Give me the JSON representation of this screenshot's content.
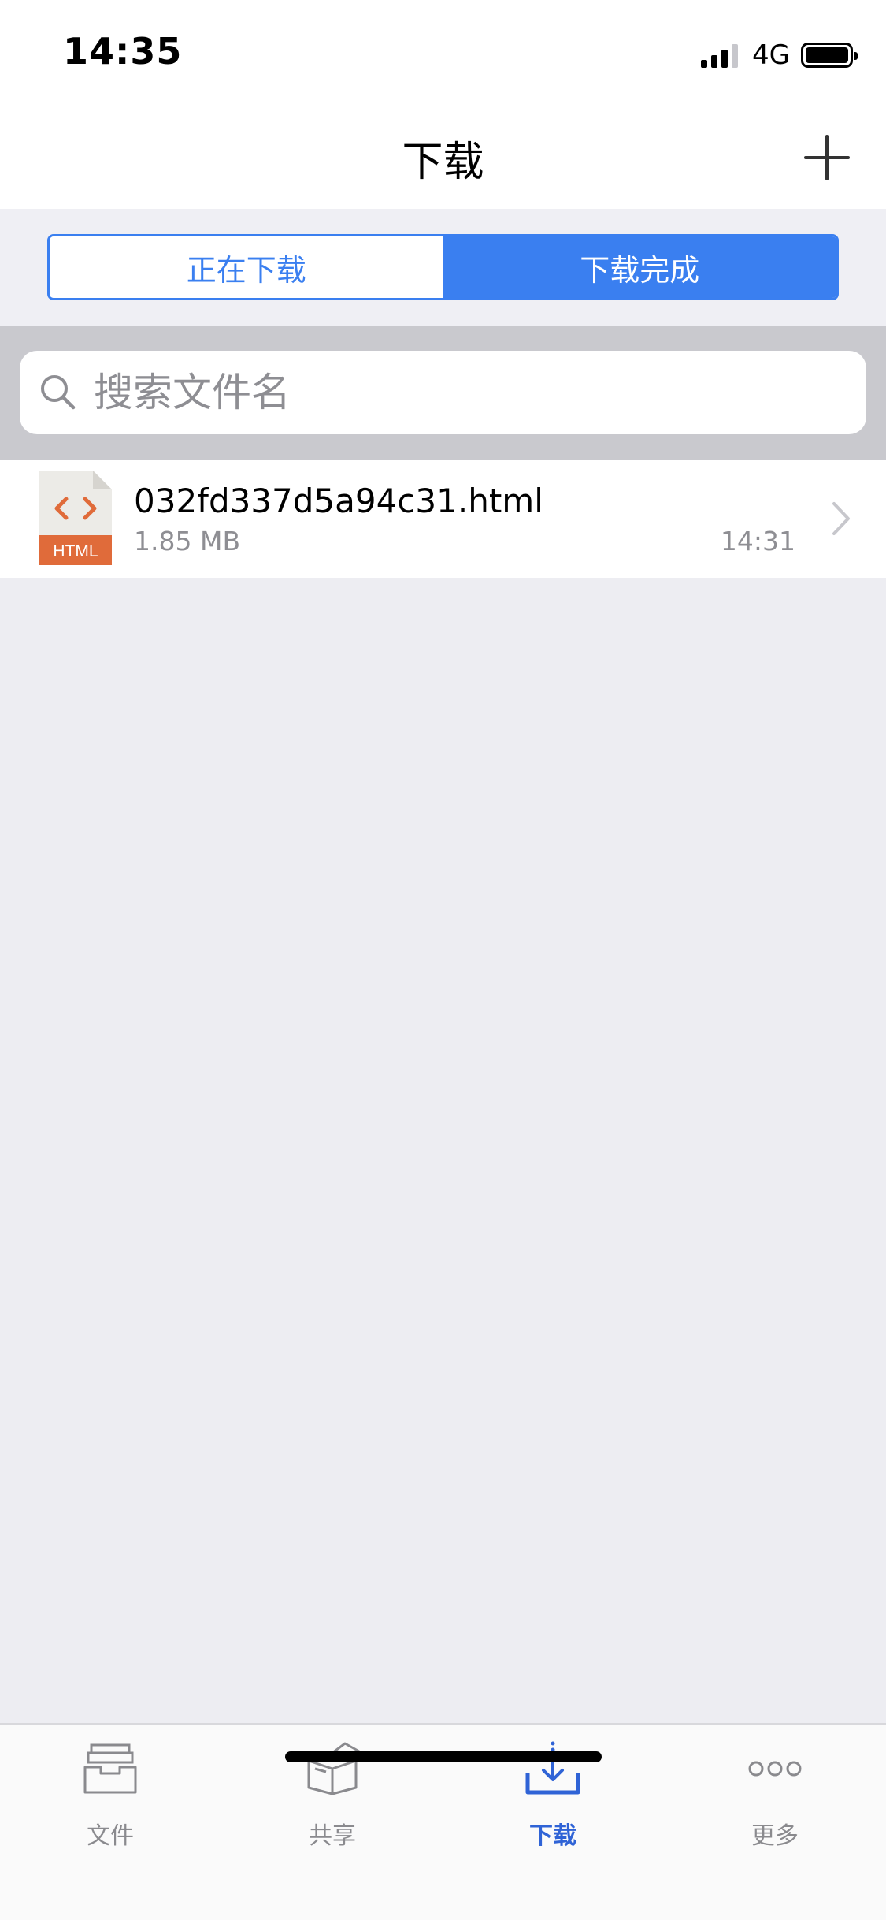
{
  "status_bar": {
    "time": "14:35",
    "network": "4G"
  },
  "nav": {
    "title": "下载"
  },
  "segments": {
    "items": [
      "正在下载",
      "下载完成"
    ],
    "active_index": 1
  },
  "search": {
    "placeholder": "搜索文件名"
  },
  "files": [
    {
      "icon_label": "HTML",
      "name": "032fd337d5a94c31.html",
      "size": "1.85 MB",
      "time": "14:31"
    }
  ],
  "tabbar": {
    "items": [
      {
        "label": "文件",
        "icon": "inbox-tray-icon"
      },
      {
        "label": "共享",
        "icon": "open-box-icon"
      },
      {
        "label": "下载",
        "icon": "download-icon"
      },
      {
        "label": "更多",
        "icon": "more-dots-icon"
      }
    ],
    "active_index": 2
  },
  "colors": {
    "accent": "#3a7ff0",
    "tab_active": "#2f63d6",
    "file_icon": "#e06b3a",
    "background": "#ededf2"
  }
}
